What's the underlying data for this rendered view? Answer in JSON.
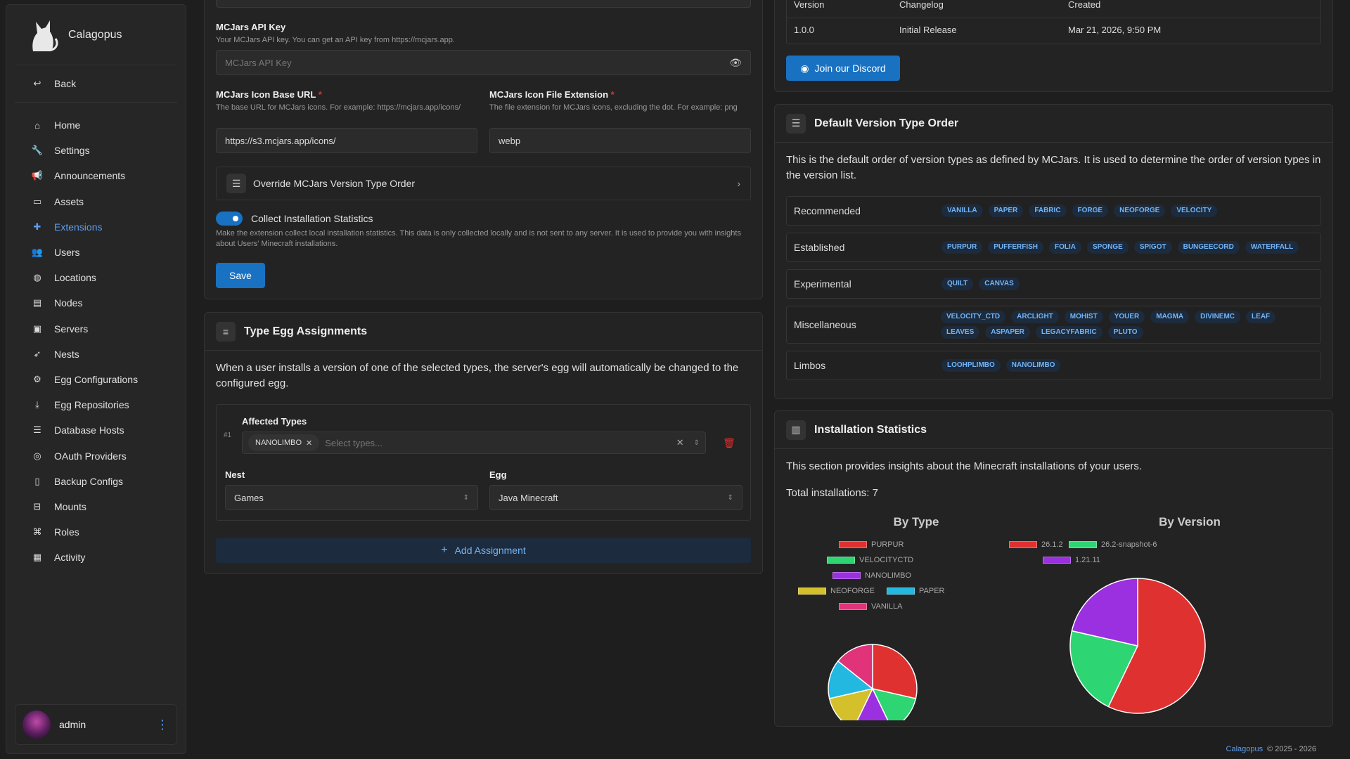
{
  "app": {
    "name": "Calagopus"
  },
  "sidebar": {
    "back_label": "Back",
    "items": [
      {
        "label": "Home",
        "icon": "home-icon"
      },
      {
        "label": "Settings",
        "icon": "wrench-icon"
      },
      {
        "label": "Announcements",
        "icon": "megaphone-icon"
      },
      {
        "label": "Assets",
        "icon": "folder-icon"
      },
      {
        "label": "Extensions",
        "icon": "puzzle-icon",
        "active": true
      },
      {
        "label": "Users",
        "icon": "users-icon"
      },
      {
        "label": "Locations",
        "icon": "globe-icon"
      },
      {
        "label": "Nodes",
        "icon": "server-icon"
      },
      {
        "label": "Servers",
        "icon": "servers-icon"
      },
      {
        "label": "Nests",
        "icon": "feather-icon"
      },
      {
        "label": "Egg Configurations",
        "icon": "gears-icon"
      },
      {
        "label": "Egg Repositories",
        "icon": "download-icon"
      },
      {
        "label": "Database Hosts",
        "icon": "database-icon"
      },
      {
        "label": "OAuth Providers",
        "icon": "fingerprint-icon"
      },
      {
        "label": "Backup Configs",
        "icon": "file-icon"
      },
      {
        "label": "Mounts",
        "icon": "mounts-icon"
      },
      {
        "label": "Roles",
        "icon": "roles-icon"
      },
      {
        "label": "Activity",
        "icon": "briefcase-icon"
      }
    ],
    "user": {
      "name": "admin"
    }
  },
  "settings_form": {
    "api_key": {
      "label": "MCJars API Key",
      "description": "Your MCJars API key. You can get an API key from https://mcjars.app.",
      "placeholder": "MCJars API Key"
    },
    "icon_base_url": {
      "label": "MCJars Icon Base URL",
      "required_mark": "*",
      "description": "The base URL for MCJars icons. For example: https://mcjars.app/icons/",
      "value": "https://s3.mcjars.app/icons/"
    },
    "icon_ext": {
      "label": "MCJars Icon File Extension",
      "required_mark": "*",
      "description": "The file extension for MCJars icons, excluding the dot. For example: png",
      "value": "webp"
    },
    "override_label": "Override MCJars Version Type Order",
    "collect_stats": {
      "label": "Collect Installation Statistics",
      "enabled": true,
      "description": "Make the extension collect local installation statistics. This data is only collected locally and is not sent to any server. It is used to provide you with insights about Users' Minecraft installations."
    },
    "save_label": "Save"
  },
  "egg_assignments": {
    "title": "Type Egg Assignments",
    "description": "When a user installs a version of one of the selected types, the server's egg will automatically be changed to the configured egg.",
    "assignment": {
      "index": "#1",
      "affected_label": "Affected Types",
      "selected": [
        "NANOLIMBO"
      ],
      "select_placeholder": "Select types...",
      "nest_label": "Nest",
      "nest_value": "Games",
      "egg_label": "Egg",
      "egg_value": "Java Minecraft"
    },
    "add_label": "Add Assignment"
  },
  "versions": {
    "headers": [
      "Version",
      "Changelog",
      "Created"
    ],
    "rows": [
      {
        "version": "1.0.0",
        "changelog": "Initial Release",
        "created": "Mar 21, 2026, 9:50 PM"
      }
    ],
    "discord_label": "Join our Discord"
  },
  "version_order": {
    "title": "Default Version Type Order",
    "description": "This is the default order of version types as defined by MCJars. It is used to determine the order of version types in the version list.",
    "groups": [
      {
        "name": "Recommended",
        "types": [
          "VANILLA",
          "PAPER",
          "FABRIC",
          "FORGE",
          "NEOFORGE",
          "VELOCITY"
        ]
      },
      {
        "name": "Established",
        "types": [
          "PURPUR",
          "PUFFERFISH",
          "FOLIA",
          "SPONGE",
          "SPIGOT",
          "BUNGEECORD",
          "WATERFALL"
        ]
      },
      {
        "name": "Experimental",
        "types": [
          "QUILT",
          "CANVAS"
        ]
      },
      {
        "name": "Miscellaneous",
        "types": [
          "VELOCITY_CTD",
          "ARCLIGHT",
          "MOHIST",
          "YOUER",
          "MAGMA",
          "DIVINEMC",
          "LEAF",
          "LEAVES",
          "ASPAPER",
          "LEGACYFABRIC",
          "PLUTO"
        ]
      },
      {
        "name": "Limbos",
        "types": [
          "LOOHPLIMBO",
          "NANOLIMBO"
        ]
      }
    ]
  },
  "install_stats": {
    "title": "Installation Statistics",
    "description": "This section provides insights about the Minecraft installations of your users.",
    "total_text": "Total installations: 7"
  },
  "chart_data": [
    {
      "type": "pie",
      "title": "By Type",
      "series": [
        {
          "name": "PURPUR",
          "value": 2,
          "color": "#e03131"
        },
        {
          "name": "VELOCITYCTD",
          "value": 1,
          "color": "#2ed573"
        },
        {
          "name": "NANOLIMBO",
          "value": 1,
          "color": "#9b30e0"
        },
        {
          "name": "NEOFORGE",
          "value": 1,
          "color": "#d4c02a"
        },
        {
          "name": "PAPER",
          "value": 1,
          "color": "#22b8e0"
        },
        {
          "name": "VANILLA",
          "value": 1,
          "color": "#e0337a"
        }
      ],
      "legend": "top"
    },
    {
      "type": "pie",
      "title": "By Version",
      "series": [
        {
          "name": "26.1.2",
          "value": 4,
          "color": "#e03131"
        },
        {
          "name": "26.2-snapshot-6",
          "value": 1.5,
          "color": "#2ed573"
        },
        {
          "name": "1.21.11",
          "value": 1.5,
          "color": "#9b30e0"
        }
      ],
      "legend": "top"
    }
  ],
  "footer": {
    "brand": "Calagopus",
    "copyright": "© 2025 - 2026"
  }
}
